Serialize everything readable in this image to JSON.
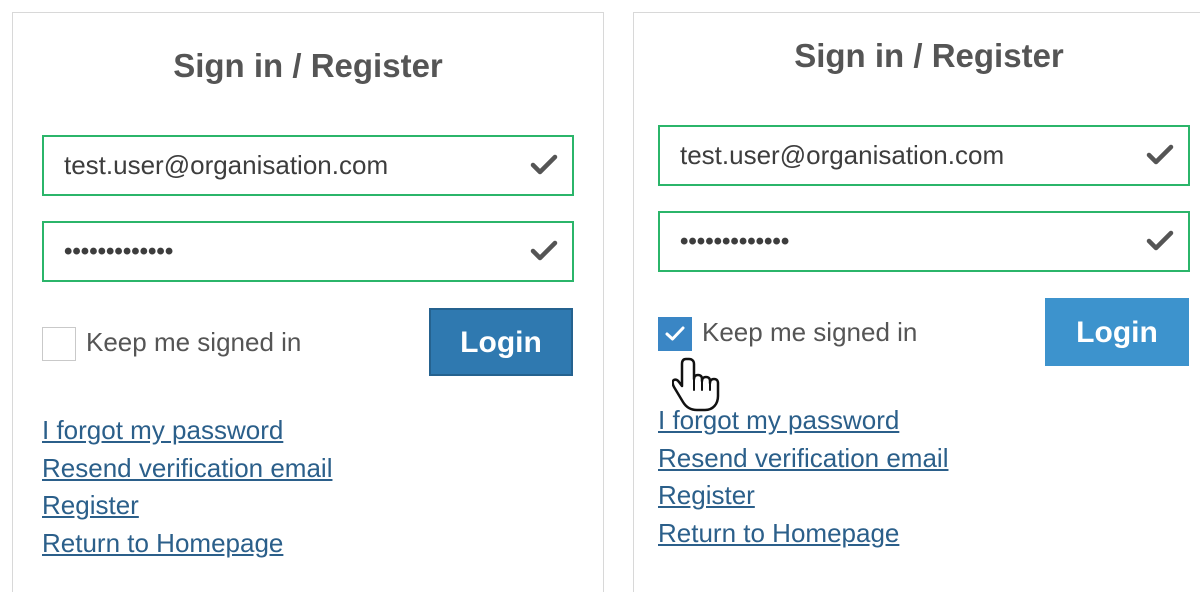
{
  "panels": [
    {
      "title": "Sign in / Register",
      "email": "test.user@organisation.com",
      "password_mask": "•••••••••••••",
      "remember_label": "Keep me signed in",
      "remember_checked": false,
      "login_label": "Login",
      "links": [
        "I forgot my password",
        "Resend verification email",
        "Register",
        "Return to Homepage"
      ]
    },
    {
      "title": "Sign in / Register",
      "email": "test.user@organisation.com",
      "password_mask": "•••••••••••••",
      "remember_label": "Keep me signed in",
      "remember_checked": true,
      "login_label": "Login",
      "links": [
        "I forgot my password",
        "Resend verification email",
        "Register",
        "Return to Homepage"
      ]
    }
  ],
  "icons": {
    "field_valid": "checkmark-icon",
    "checkbox_mark": "checkmark-icon",
    "pointer": "hand-pointer-icon"
  },
  "colors": {
    "field_border_valid": "#2bb56a",
    "button": "#2f79b0",
    "button_hover": "#3d93cd",
    "link": "#2b5f8a",
    "checkbox_checked": "#3a86c5",
    "text": "#555555"
  }
}
